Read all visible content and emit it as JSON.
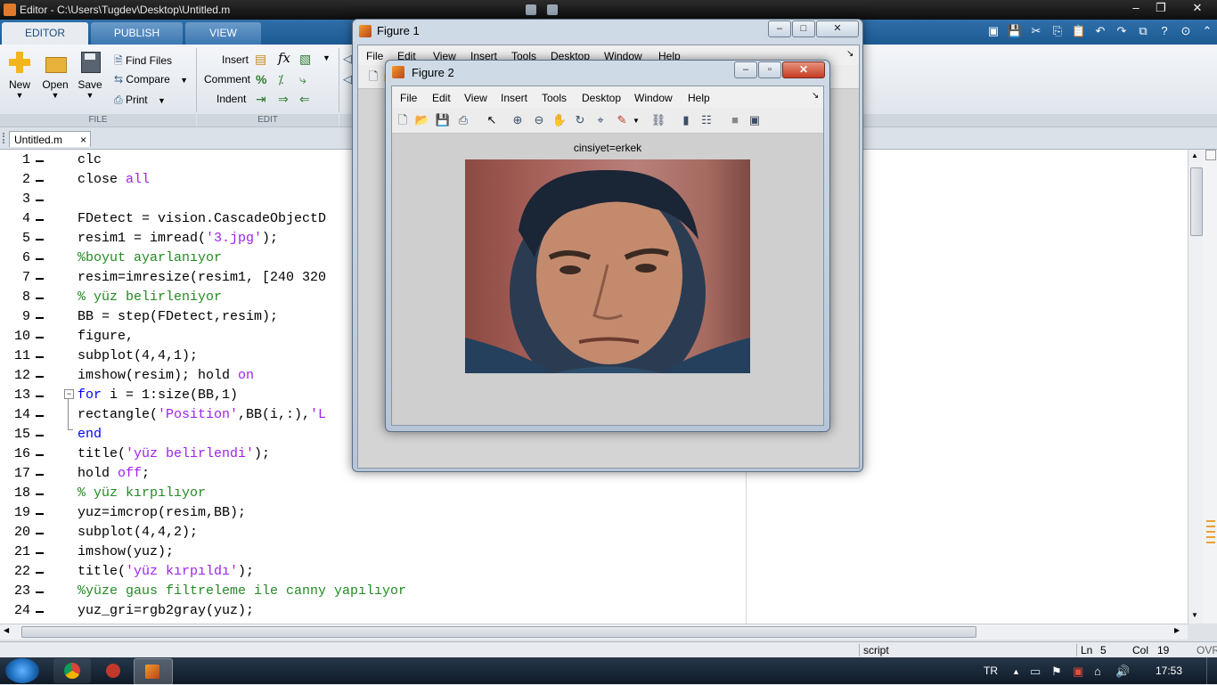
{
  "window": {
    "title": "Editor - C:\\Users\\Tugdev\\Desktop\\Untitled.m",
    "min": "–",
    "max": "❐",
    "close": "✕"
  },
  "ribbon": {
    "tabs": [
      "EDITOR",
      "PUBLISH",
      "VIEW"
    ],
    "file": {
      "new": "New",
      "open": "Open",
      "save": "Save",
      "find_files": "Find Files",
      "compare": "Compare",
      "print": "Print",
      "section": "FILE"
    },
    "edit": {
      "insert": "Insert",
      "comment": "Comment",
      "indent": "Indent",
      "section": "EDIT"
    }
  },
  "doc_tab": {
    "name": "Untitled.m",
    "close": "×"
  },
  "code_lines": [
    {
      "n": "1",
      "parts": [
        {
          "t": "clc",
          "c": ""
        }
      ]
    },
    {
      "n": "2",
      "parts": [
        {
          "t": "close ",
          "c": ""
        },
        {
          "t": "all",
          "c": "str"
        }
      ]
    },
    {
      "n": "3",
      "parts": []
    },
    {
      "n": "4",
      "parts": [
        {
          "t": "FDetect = vision.CascadeObjectD",
          "c": ""
        }
      ]
    },
    {
      "n": "5",
      "parts": [
        {
          "t": "resim1 = imread(",
          "c": ""
        },
        {
          "t": "'3.jpg'",
          "c": "str"
        },
        {
          "t": ");",
          "c": ""
        }
      ]
    },
    {
      "n": "6",
      "parts": [
        {
          "t": "%boyut ayarlanıyor",
          "c": "cm"
        }
      ]
    },
    {
      "n": "7",
      "parts": [
        {
          "t": "resim=imresize(resim1, [240 320",
          "c": ""
        }
      ]
    },
    {
      "n": "8",
      "parts": [
        {
          "t": "% yüz belirleniyor",
          "c": "cm"
        }
      ]
    },
    {
      "n": "9",
      "parts": [
        {
          "t": "BB = step(FDetect,resim);",
          "c": ""
        }
      ]
    },
    {
      "n": "10",
      "parts": [
        {
          "t": "figure,",
          "c": ""
        }
      ]
    },
    {
      "n": "11",
      "parts": [
        {
          "t": "subplot(4,4,1);",
          "c": ""
        }
      ]
    },
    {
      "n": "12",
      "parts": [
        {
          "t": "imshow(resim); hold ",
          "c": ""
        },
        {
          "t": "on",
          "c": "str"
        }
      ]
    },
    {
      "n": "13",
      "parts": [
        {
          "t": "for",
          "c": "kw"
        },
        {
          "t": " i = 1:size(BB,1)",
          "c": ""
        }
      ]
    },
    {
      "n": "14",
      "parts": [
        {
          "t": "rectangle(",
          "c": ""
        },
        {
          "t": "'Position'",
          "c": "str"
        },
        {
          "t": ",BB(i,:),",
          "c": ""
        },
        {
          "t": "'L",
          "c": "str"
        }
      ]
    },
    {
      "n": "15",
      "parts": [
        {
          "t": "end",
          "c": "kw"
        }
      ]
    },
    {
      "n": "16",
      "parts": [
        {
          "t": "title(",
          "c": ""
        },
        {
          "t": "'yüz belirlendi'",
          "c": "str"
        },
        {
          "t": ");",
          "c": ""
        }
      ]
    },
    {
      "n": "17",
      "parts": [
        {
          "t": "hold ",
          "c": ""
        },
        {
          "t": "off",
          "c": "str"
        },
        {
          "t": ";",
          "c": ""
        }
      ]
    },
    {
      "n": "18",
      "parts": [
        {
          "t": "% yüz kırpılıyor",
          "c": "cm"
        }
      ]
    },
    {
      "n": "19",
      "parts": [
        {
          "t": "yuz=imcrop(resim,BB);",
          "c": ""
        }
      ]
    },
    {
      "n": "20",
      "parts": [
        {
          "t": "subplot(4,4,2);",
          "c": ""
        }
      ]
    },
    {
      "n": "21",
      "parts": [
        {
          "t": "imshow(yuz);",
          "c": ""
        }
      ]
    },
    {
      "n": "22",
      "parts": [
        {
          "t": "title(",
          "c": ""
        },
        {
          "t": "'yüz kırpıldı'",
          "c": "str"
        },
        {
          "t": ");",
          "c": ""
        }
      ]
    },
    {
      "n": "23",
      "parts": [
        {
          "t": "%yüze gaus filtreleme ile canny yapılıyor",
          "c": "cm"
        }
      ]
    },
    {
      "n": "24",
      "parts": [
        {
          "t": "yuz_gri=rgb2gray(yuz);",
          "c": ""
        }
      ]
    }
  ],
  "figure1": {
    "title": "Figure 1",
    "menu": [
      "File",
      "Edit",
      "View",
      "Insert",
      "Tools",
      "Desktop",
      "Window",
      "Help"
    ]
  },
  "figure2": {
    "title": "Figure 2",
    "menu": [
      "File",
      "Edit",
      "View",
      "Insert",
      "Tools",
      "Desktop",
      "Window",
      "Help"
    ],
    "axes_title": "cinsiyet=erkek"
  },
  "statusbar": {
    "mode": "script",
    "ln_label": "Ln",
    "ln": "5",
    "col_label": "Col",
    "col": "19",
    "ovr": "OVR"
  },
  "taskbar": {
    "lang": "TR",
    "time": "17:53"
  }
}
